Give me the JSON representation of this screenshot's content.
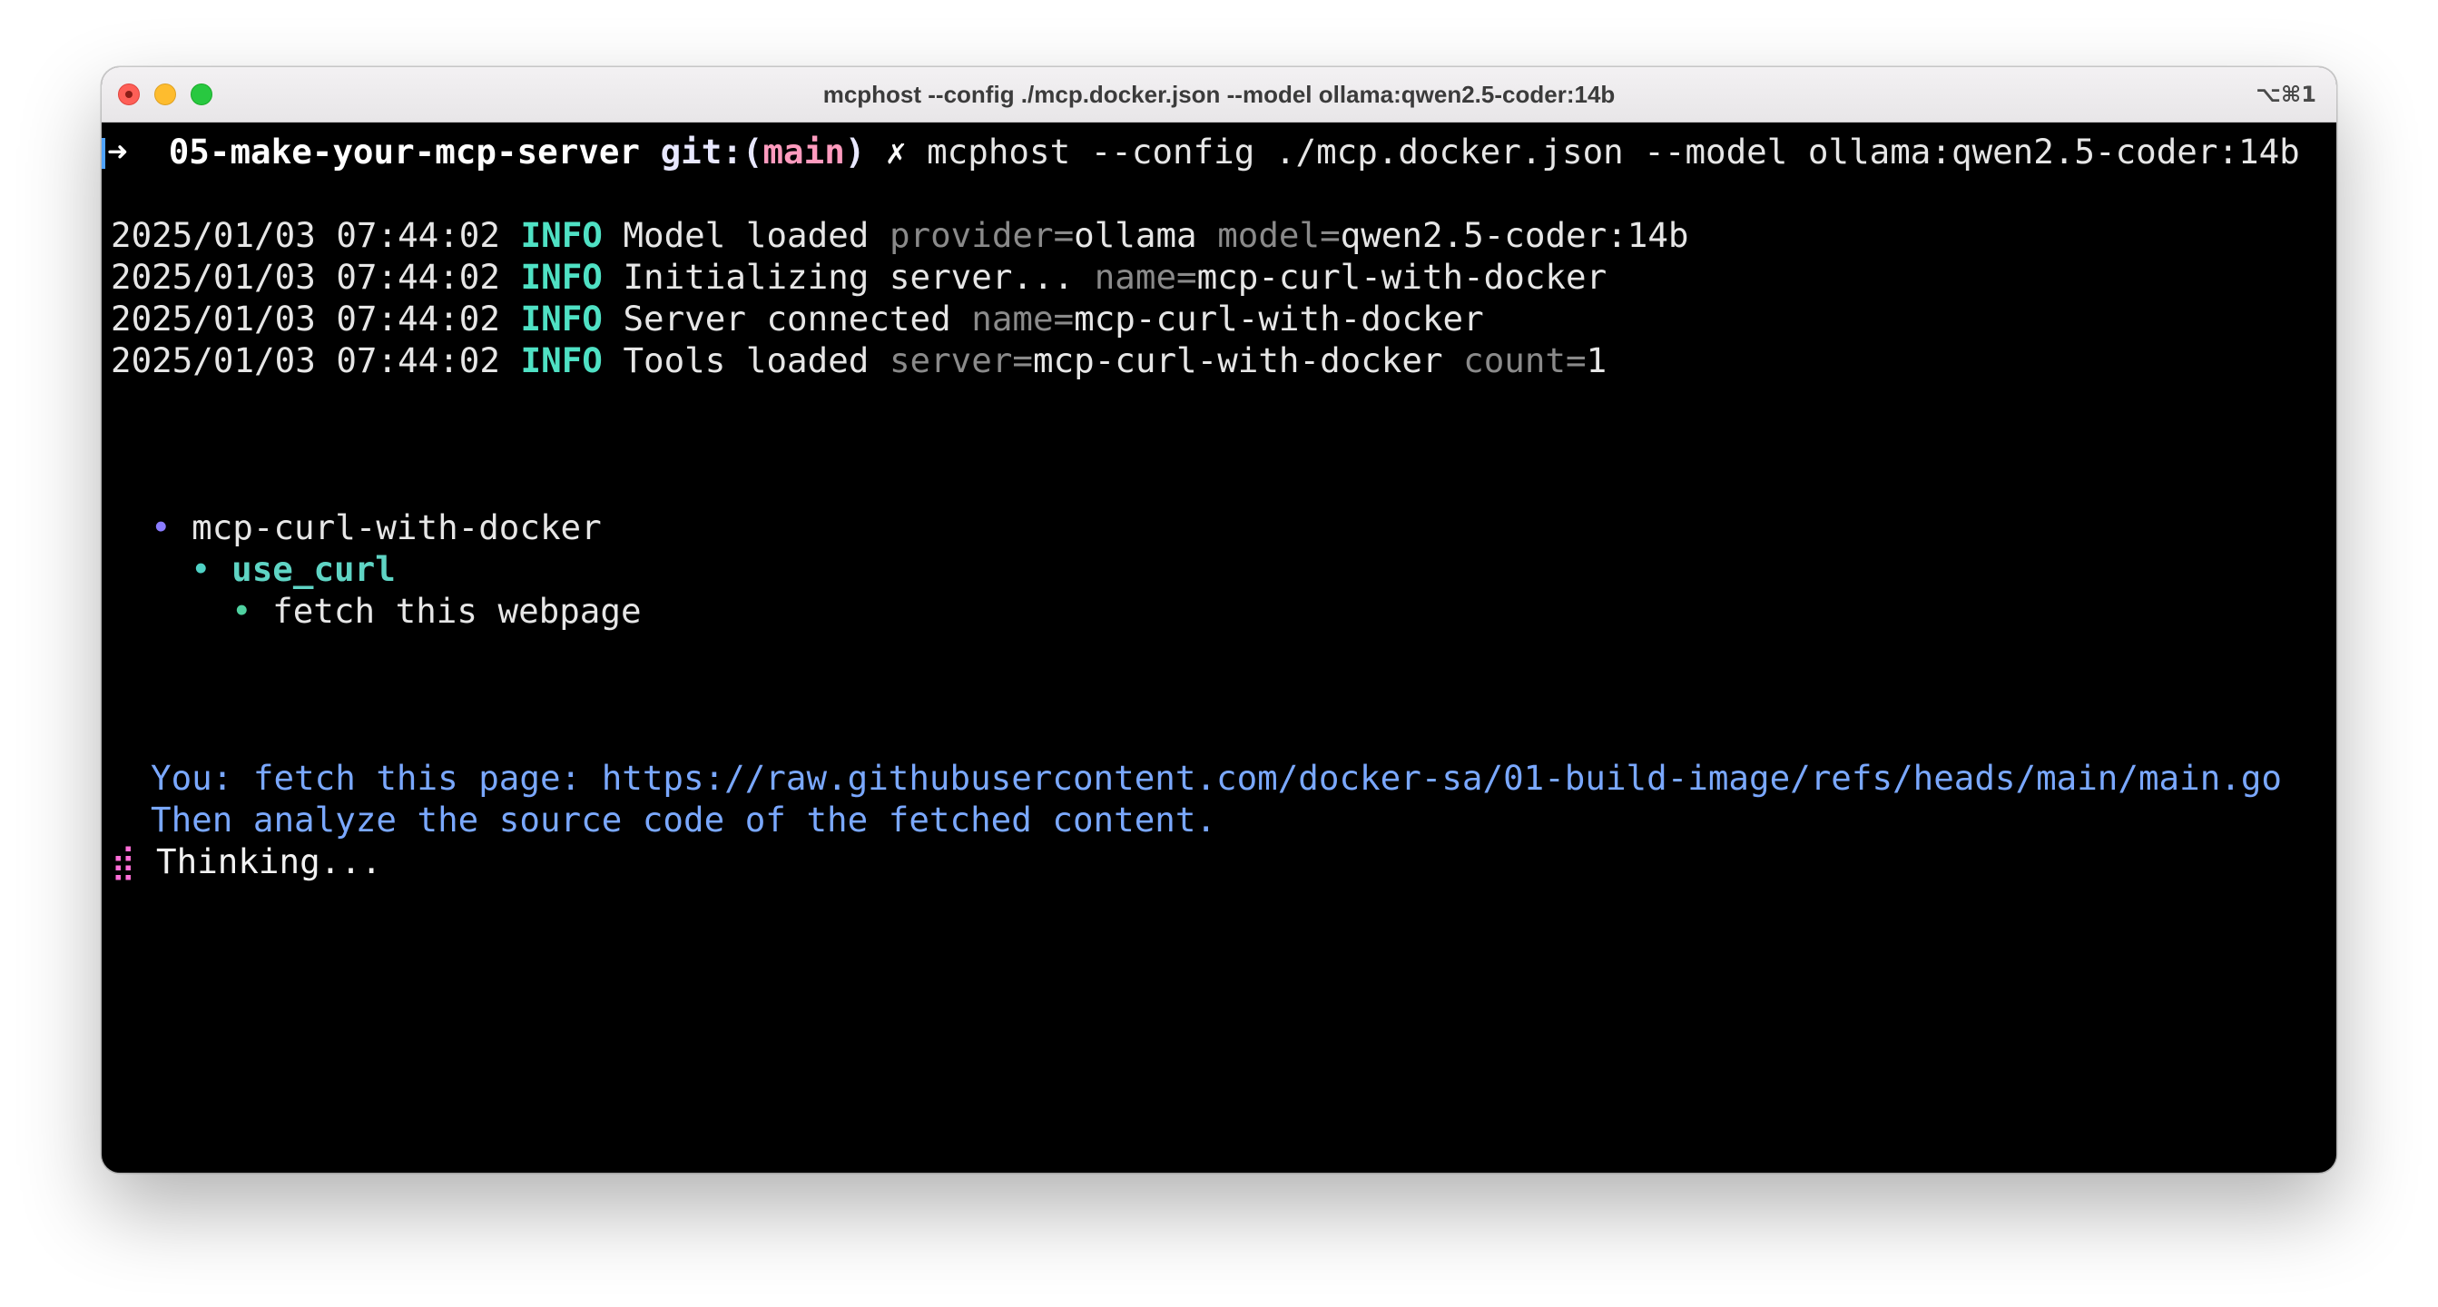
{
  "window": {
    "title": "mcphost --config ./mcp.docker.json --model ollama:qwen2.5-coder:14b",
    "shortcut": "⌥⌘1"
  },
  "prompt": {
    "arrow": "➜",
    "directory": "05-make-your-mcp-server",
    "git_prefix": "git:(",
    "branch": "main",
    "git_suffix": ")",
    "dirty_mark": "✗",
    "command": "mcphost --config ./mcp.docker.json --model ollama:qwen2.5-coder:14b"
  },
  "logs": [
    {
      "timestamp": "2025/01/03 07:44:02",
      "level": "INFO",
      "message": "Model loaded",
      "fields": [
        {
          "key": "provider=",
          "value": "ollama"
        },
        {
          "key": "model=",
          "value": "qwen2.5-coder:14b"
        }
      ]
    },
    {
      "timestamp": "2025/01/03 07:44:02",
      "level": "INFO",
      "message": "Initializing server...",
      "fields": [
        {
          "key": "name=",
          "value": "mcp-curl-with-docker"
        }
      ]
    },
    {
      "timestamp": "2025/01/03 07:44:02",
      "level": "INFO",
      "message": "Server connected",
      "fields": [
        {
          "key": "name=",
          "value": "mcp-curl-with-docker"
        }
      ]
    },
    {
      "timestamp": "2025/01/03 07:44:02",
      "level": "INFO",
      "message": "Tools loaded",
      "fields": [
        {
          "key": "server=",
          "value": "mcp-curl-with-docker"
        },
        {
          "key": "count=",
          "value": "1"
        }
      ]
    }
  ],
  "tools_tree": {
    "bullet": "•",
    "server": "mcp-curl-with-docker",
    "tool": "use_curl",
    "description": "fetch this webpage"
  },
  "conversation": {
    "user_line_1": "You: fetch this page: https://raw.githubusercontent.com/docker-sa/01-build-image/refs/heads/main/main.go",
    "user_line_2": "Then analyze the source code of the fetched content.",
    "spinner": "⣾",
    "status": "Thinking..."
  },
  "colors": {
    "terminal_background": "#000000",
    "info_level": "#4fe1c4",
    "branch": "#ff9bbe",
    "user_message": "#7aa8ff",
    "spinner": "#ff6fd8"
  },
  "icons": [
    "window-close-icon",
    "window-minimize-icon",
    "window-maximize-icon",
    "prompt-arrow-icon",
    "spinner-icon"
  ]
}
